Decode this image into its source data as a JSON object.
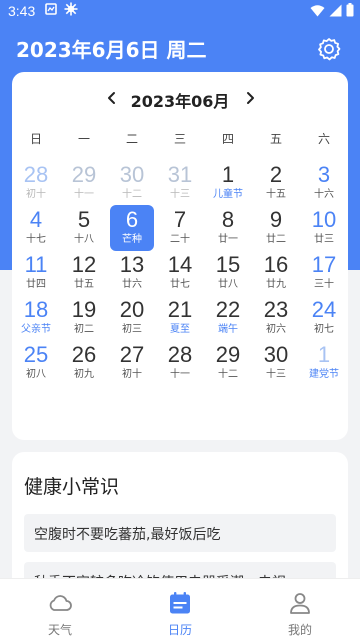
{
  "status_bar": {
    "time": "3:43"
  },
  "header": {
    "title": "2023年6月6日 周二"
  },
  "calendar": {
    "month_title": "2023年06月",
    "prev_symbol": "‹",
    "next_symbol": "›",
    "weekdays": [
      "日",
      "一",
      "二",
      "三",
      "四",
      "五",
      "六"
    ],
    "weeks": [
      [
        {
          "day": "28",
          "sub": "初十",
          "other": true
        },
        {
          "day": "29",
          "sub": "十一",
          "other": true
        },
        {
          "day": "30",
          "sub": "十二",
          "other": true
        },
        {
          "day": "31",
          "sub": "十三",
          "other": true
        },
        {
          "day": "1",
          "sub": "儿童节",
          "fest": true
        },
        {
          "day": "2",
          "sub": "十五"
        },
        {
          "day": "3",
          "sub": "十六"
        }
      ],
      [
        {
          "day": "4",
          "sub": "十七"
        },
        {
          "day": "5",
          "sub": "十八"
        },
        {
          "day": "6",
          "sub": "芒种",
          "today": true
        },
        {
          "day": "7",
          "sub": "二十"
        },
        {
          "day": "8",
          "sub": "廿一"
        },
        {
          "day": "9",
          "sub": "廿二"
        },
        {
          "day": "10",
          "sub": "廿三"
        }
      ],
      [
        {
          "day": "11",
          "sub": "廿四"
        },
        {
          "day": "12",
          "sub": "廿五"
        },
        {
          "day": "13",
          "sub": "廿六"
        },
        {
          "day": "14",
          "sub": "廿七"
        },
        {
          "day": "15",
          "sub": "廿八"
        },
        {
          "day": "16",
          "sub": "廿九"
        },
        {
          "day": "17",
          "sub": "三十"
        }
      ],
      [
        {
          "day": "18",
          "sub": "父亲节",
          "fest": true
        },
        {
          "day": "19",
          "sub": "初二"
        },
        {
          "day": "20",
          "sub": "初三"
        },
        {
          "day": "21",
          "sub": "夏至",
          "fest": true
        },
        {
          "day": "22",
          "sub": "端午",
          "fest": true
        },
        {
          "day": "23",
          "sub": "初六"
        },
        {
          "day": "24",
          "sub": "初七"
        }
      ],
      [
        {
          "day": "25",
          "sub": "初八"
        },
        {
          "day": "26",
          "sub": "初九"
        },
        {
          "day": "27",
          "sub": "初十"
        },
        {
          "day": "28",
          "sub": "十一"
        },
        {
          "day": "29",
          "sub": "十二"
        },
        {
          "day": "30",
          "sub": "十三"
        },
        {
          "day": "1",
          "sub": "建党节",
          "other": true,
          "fest": true
        }
      ]
    ]
  },
  "health": {
    "title": "健康小常识",
    "tips": [
      "空腹时不要吃蕃茄,最好饭后吃",
      "秋季不宜较多吃冷饮使用电器受潮，电视"
    ]
  },
  "bottom_nav": [
    {
      "label": "天气",
      "icon": "cloud-icon",
      "active": false
    },
    {
      "label": "日历",
      "icon": "calendar-icon",
      "active": true
    },
    {
      "label": "我的",
      "icon": "person-icon",
      "active": false
    }
  ],
  "colors": {
    "primary": "#4b83f5",
    "background": "#f2f3f5"
  }
}
